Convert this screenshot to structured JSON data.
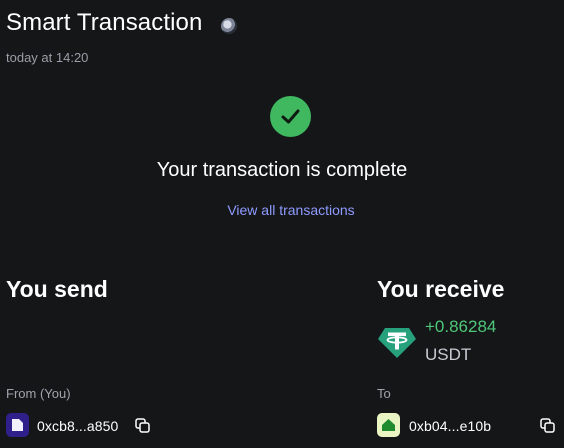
{
  "header": {
    "title": "Smart Transaction",
    "timestamp": "today at 14:20",
    "chain_icon": "network-logo-icon"
  },
  "status": {
    "icon": "check-circle-icon",
    "message": "Your transaction is complete",
    "view_all_link": "View all transactions"
  },
  "send": {
    "heading": "You send",
    "from_label": "From (You)",
    "from_address": "0xcb8...a850",
    "avatar_color": "#2e1f8a"
  },
  "receive": {
    "heading": "You receive",
    "token_icon": "tether-usdt-icon",
    "amount": "+0.86284",
    "symbol": "USDT",
    "to_label": "To",
    "to_address": "0xb04...e10b",
    "avatar_color": "#e9f5c3"
  },
  "colors": {
    "background": "#141618",
    "success": "#3fb860",
    "amount_positive": "#4fc779",
    "link": "#8f9bff",
    "tether": "#26a17b"
  }
}
